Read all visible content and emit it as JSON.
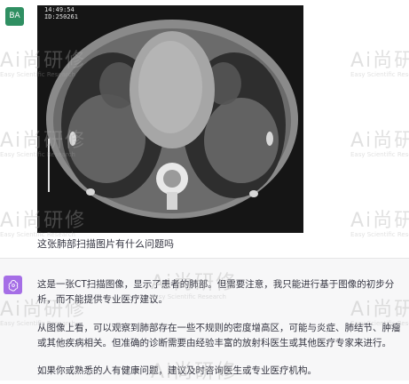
{
  "user": {
    "avatar_initials": "BA",
    "question": "这张肺部扫描图片有什么问题吗",
    "image_overlay": {
      "line1": "14:49:54",
      "line2": "ID:250261"
    }
  },
  "assistant": {
    "paragraphs": [
      "这是一张CT扫描图像，显示了患者的肺部。但需要注意，我只能进行基于图像的初步分析，而不能提供专业医疗建议。",
      "从图像上看，可以观察到肺部存在一些不规则的密度增高区，可能与炎症、肺结节、肿瘤或其他疾病相关。但准确的诊断需要由经验丰富的放射科医生或其他医疗专家来进行。",
      "如果你或熟悉的人有健康问题，建议及时咨询医生或专业医疗机构。"
    ]
  },
  "watermark": {
    "brand": "Ai尚研修",
    "subtitle": "Easy Scientific Research"
  },
  "colors": {
    "user_avatar": "#2f8f62",
    "gpt_avatar": "#a56ee6",
    "assistant_bg": "#f7f7f8"
  }
}
